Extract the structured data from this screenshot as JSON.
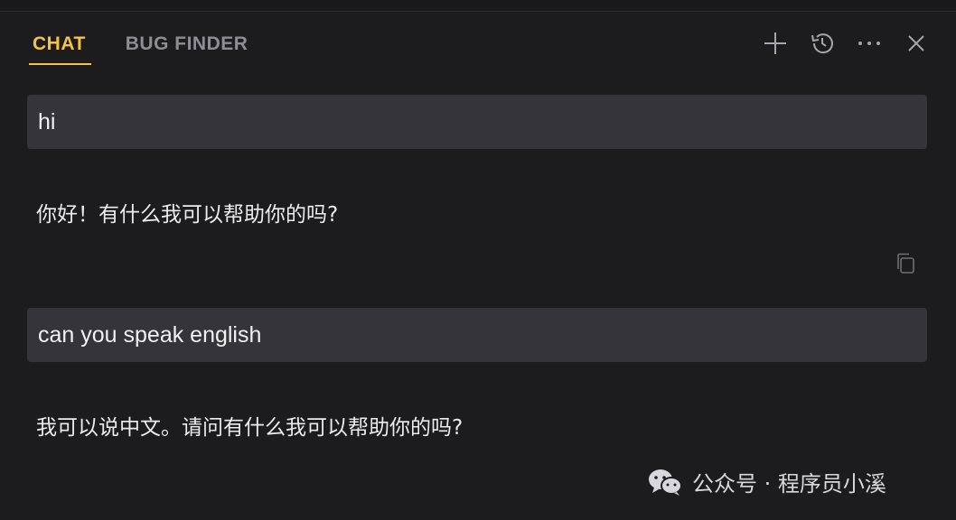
{
  "tabs": [
    {
      "label": "CHAT",
      "active": true
    },
    {
      "label": "BUG FINDER",
      "active": false
    }
  ],
  "toolbar": {
    "icons": [
      "plus-icon",
      "history-icon",
      "more-icon",
      "close-icon"
    ]
  },
  "conversation": [
    {
      "role": "user",
      "text": "hi"
    },
    {
      "role": "assistant",
      "text": "你好！有什么我可以帮助你的吗?"
    },
    {
      "role": "user",
      "text": "can you speak english"
    },
    {
      "role": "assistant",
      "text": "我可以说中文。请问有什么我可以帮助你的吗?"
    }
  ],
  "watermark": {
    "text": "公众号 · 程序员小溪",
    "icon": "wechat-icon"
  },
  "colors": {
    "accent": "#f5c343",
    "background": "#1c1b1e",
    "user_bubble": "#353438"
  }
}
